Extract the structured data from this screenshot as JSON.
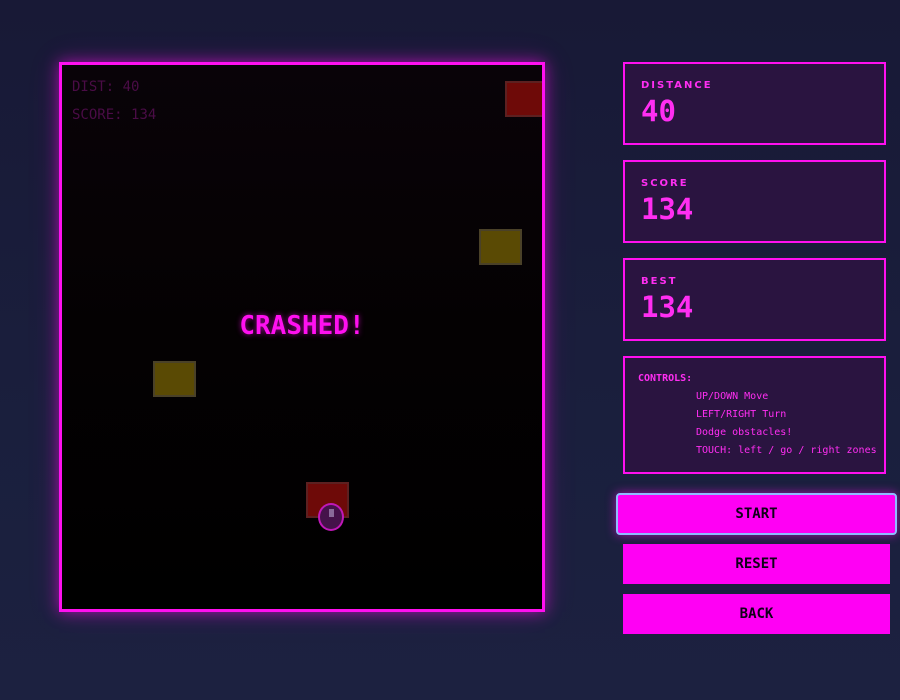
{
  "game": {
    "hud": {
      "distance_label": "DIST",
      "distance_value": "40",
      "score_label": "SCORE",
      "score_value": "134"
    },
    "status_message": "CRASHED!"
  },
  "panel": {
    "distance": {
      "label": "DISTANCE",
      "value": "40"
    },
    "score": {
      "label": "SCORE",
      "value": "134"
    },
    "best": {
      "label": "BEST",
      "value": "134"
    },
    "controls": {
      "title": "CONTROLS:",
      "lines": [
        "UP/DOWN Move",
        "LEFT/RIGHT Turn",
        "Dodge obstacles!",
        "TOUCH: left / go / right zones"
      ]
    }
  },
  "buttons": {
    "start": "START",
    "reset": "RESET",
    "back": "BACK"
  },
  "colors": {
    "accent": "#ff10f0",
    "panel_background": "#2a1440",
    "page_background": "#1a1d3c",
    "obstacle_red": "#6e0a08",
    "obstacle_yellow": "#5a4a04",
    "start_focus_ring": "#8fbcff"
  }
}
